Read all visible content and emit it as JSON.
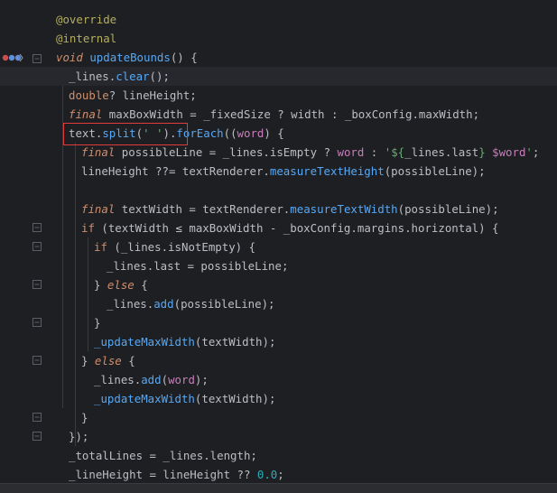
{
  "lines": [
    {
      "segs": [
        {
          "t": "@override",
          "c": "ann"
        }
      ]
    },
    {
      "segs": [
        {
          "t": "@internal",
          "c": "ann"
        }
      ]
    },
    {
      "segs": [
        {
          "t": "void",
          "c": "kw"
        },
        {
          "t": " "
        },
        {
          "t": "updateBounds",
          "c": "fn"
        },
        {
          "t": "() {"
        }
      ]
    },
    {
      "segs": [
        {
          "t": "_lines."
        },
        {
          "t": "clear",
          "c": "mth"
        },
        {
          "t": "();"
        }
      ]
    },
    {
      "segs": [
        {
          "t": "double",
          "c": "k"
        },
        {
          "t": "? lineHeight;"
        }
      ]
    },
    {
      "segs": [
        {
          "t": "final",
          "c": "kw"
        },
        {
          "t": " maxBoxWidth = _fixedSize ? width : _boxConfig.maxWidth;"
        }
      ]
    },
    {
      "segs": [
        {
          "t": "text."
        },
        {
          "t": "split",
          "c": "mth"
        },
        {
          "t": "("
        },
        {
          "t": "' '",
          "c": "str"
        },
        {
          "t": ")."
        },
        {
          "t": "forEach",
          "c": "mth"
        },
        {
          "t": "(("
        },
        {
          "t": "word",
          "c": "prm"
        },
        {
          "t": ") {"
        }
      ]
    },
    {
      "segs": [
        {
          "t": "final",
          "c": "kw"
        },
        {
          "t": " possibleLine = _lines.isEmpty ? "
        },
        {
          "t": "word",
          "c": "prm"
        },
        {
          "t": " : "
        },
        {
          "t": "'${",
          "c": "str"
        },
        {
          "t": "_lines.last"
        },
        {
          "t": "} ",
          "c": "str"
        },
        {
          "t": "$word",
          "c": "prm"
        },
        {
          "t": "'",
          "c": "str"
        },
        {
          "t": ";"
        }
      ]
    },
    {
      "segs": [
        {
          "t": "lineHeight ??= textRenderer."
        },
        {
          "t": "measureTextHeight",
          "c": "mth"
        },
        {
          "t": "(possibleLine);"
        }
      ]
    },
    {
      "segs": []
    },
    {
      "segs": [
        {
          "t": "final",
          "c": "kw"
        },
        {
          "t": " textWidth = textRenderer."
        },
        {
          "t": "measureTextWidth",
          "c": "mth"
        },
        {
          "t": "(possibleLine);"
        }
      ]
    },
    {
      "segs": [
        {
          "t": "if",
          "c": "k"
        },
        {
          "t": " (textWidth ≤ maxBoxWidth - _boxConfig.margins.horizontal) {"
        }
      ]
    },
    {
      "segs": [
        {
          "t": "if",
          "c": "k"
        },
        {
          "t": " (_lines.isNotEmpty) {"
        }
      ]
    },
    {
      "segs": [
        {
          "t": "_lines.last = possibleLine;"
        }
      ]
    },
    {
      "segs": [
        {
          "t": "} "
        },
        {
          "t": "else",
          "c": "kw"
        },
        {
          "t": " {"
        }
      ]
    },
    {
      "segs": [
        {
          "t": "_lines."
        },
        {
          "t": "add",
          "c": "mth"
        },
        {
          "t": "(possibleLine);"
        }
      ]
    },
    {
      "segs": [
        {
          "t": "}"
        }
      ]
    },
    {
      "segs": [
        {
          "t": "_updateMaxWidth",
          "c": "mth"
        },
        {
          "t": "(textWidth);"
        }
      ]
    },
    {
      "segs": [
        {
          "t": "} "
        },
        {
          "t": "else",
          "c": "kw"
        },
        {
          "t": " {"
        }
      ]
    },
    {
      "segs": [
        {
          "t": "_lines."
        },
        {
          "t": "add",
          "c": "mth"
        },
        {
          "t": "("
        },
        {
          "t": "word",
          "c": "prm"
        },
        {
          "t": ");"
        }
      ]
    },
    {
      "segs": [
        {
          "t": "_updateMaxWidth",
          "c": "mth"
        },
        {
          "t": "(textWidth);"
        }
      ]
    },
    {
      "segs": [
        {
          "t": "}"
        }
      ]
    },
    {
      "segs": [
        {
          "t": "});"
        }
      ]
    },
    {
      "segs": [
        {
          "t": "_totalLines = _lines.length;"
        }
      ]
    },
    {
      "segs": [
        {
          "t": "_lineHeight = lineHeight ?? "
        },
        {
          "t": "0.0",
          "c": "num"
        },
        {
          "t": ";"
        }
      ]
    }
  ],
  "colors": {
    "background": "#1e1f22",
    "current_line": "#26282e",
    "highlight_box": "#e23b3b"
  },
  "gutter_icons": {
    "override_marker": "override-method-icon"
  }
}
